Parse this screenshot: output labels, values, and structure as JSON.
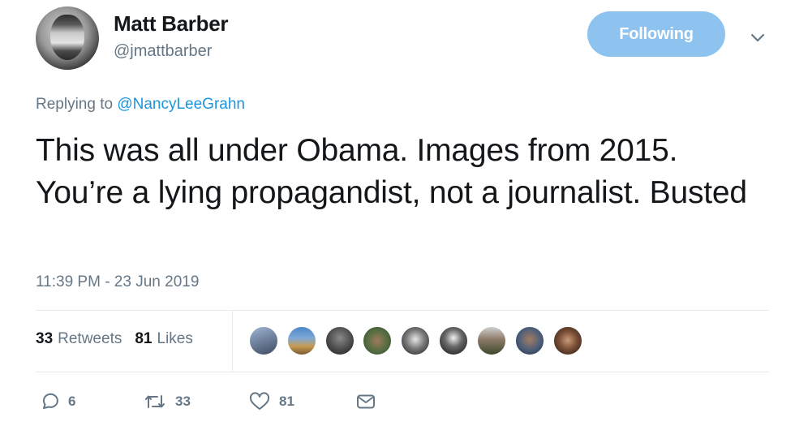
{
  "header": {
    "display_name": "Matt Barber",
    "screen_name": "@jmattbarber",
    "follow_label": "Following"
  },
  "reply": {
    "prefix": "Replying to",
    "mention": "@NancyLeeGrahn"
  },
  "tweet": {
    "text": "This was all under Obama. Images from 2015. You’re a lying propagandist, not a journalist. Busted",
    "timestamp": "11:39 PM - 23 Jun 2019"
  },
  "stats": {
    "retweets_count": "33",
    "retweets_label": "Retweets",
    "likes_count": "81",
    "likes_label": "Likes"
  },
  "actions": {
    "reply_count": "6",
    "retweet_count": "33",
    "like_count": "81"
  },
  "colors": {
    "follow_button": "#8ec3f0",
    "mention": "#1b95e0",
    "secondary_text": "#657786"
  },
  "icons": [
    "caret-down-icon",
    "reply-icon",
    "retweet-icon",
    "like-icon",
    "direct-message-icon"
  ]
}
